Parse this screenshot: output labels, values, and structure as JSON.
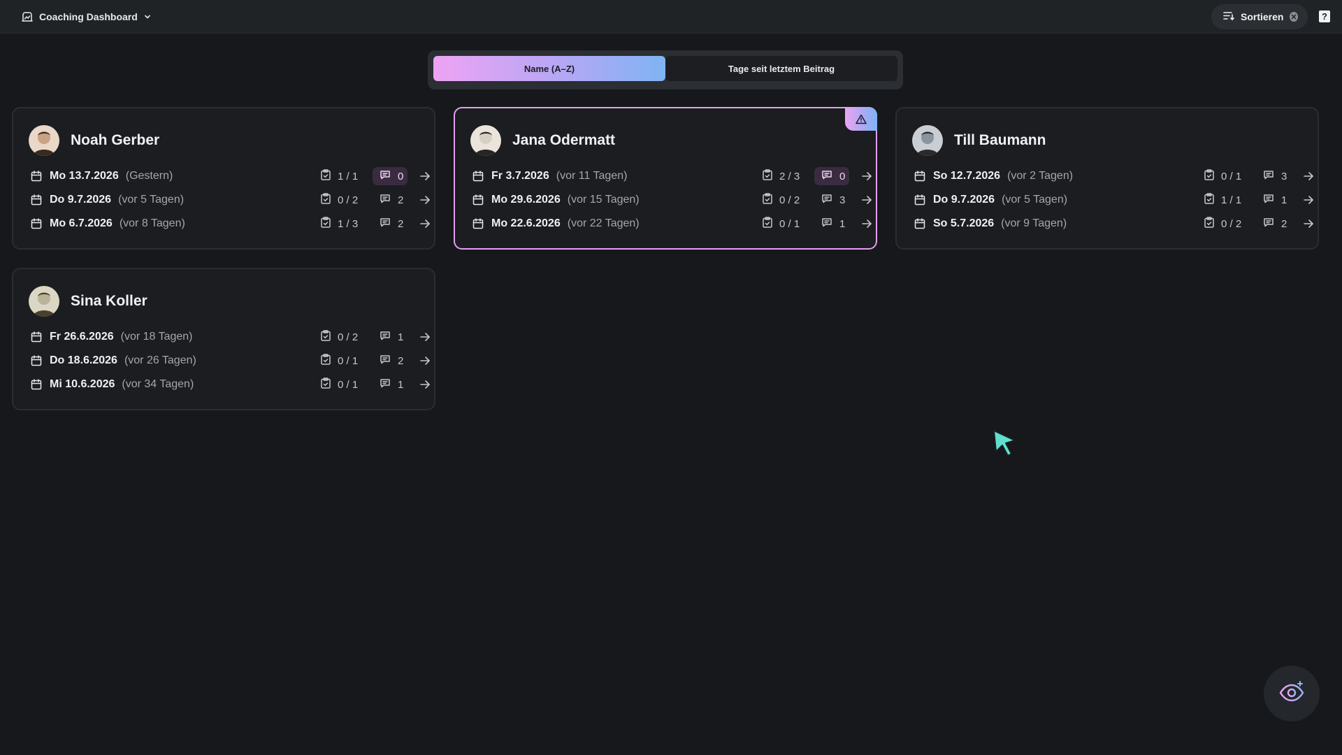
{
  "topbar": {
    "dashboard_title": "Coaching Dashboard",
    "sort_label": "Sortieren",
    "help_label": "?"
  },
  "sort_options": [
    {
      "label": "Name (A–Z)",
      "active": true
    },
    {
      "label": "Tage seit letztem Beitrag",
      "active": false
    }
  ],
  "colors": {
    "accent_gradient_start": "#eea3f3",
    "accent_gradient_end": "#7fb4f3",
    "highlight_border": "#e59ef0",
    "comment_highlight_bg": "#3a2b40"
  },
  "cards": [
    {
      "name": "Noah Gerber",
      "warning": false,
      "rows": [
        {
          "date": "Mo 13.7.2026",
          "relative": "(Gestern)",
          "tasks": "1 / 1",
          "comments": "0",
          "comments_highlight": true
        },
        {
          "date": "Do 9.7.2026",
          "relative": "(vor 5 Tagen)",
          "tasks": "0 / 2",
          "comments": "2",
          "comments_highlight": false
        },
        {
          "date": "Mo 6.7.2026",
          "relative": "(vor 8 Tagen)",
          "tasks": "1 / 3",
          "comments": "2",
          "comments_highlight": false
        }
      ]
    },
    {
      "name": "Jana Odermatt",
      "warning": true,
      "rows": [
        {
          "date": "Fr 3.7.2026",
          "relative": "(vor 11 Tagen)",
          "tasks": "2 / 3",
          "comments": "0",
          "comments_highlight": true
        },
        {
          "date": "Mo 29.6.2026",
          "relative": "(vor 15 Tagen)",
          "tasks": "0 / 2",
          "comments": "3",
          "comments_highlight": false
        },
        {
          "date": "Mo 22.6.2026",
          "relative": "(vor 22 Tagen)",
          "tasks": "0 / 1",
          "comments": "1",
          "comments_highlight": false
        }
      ]
    },
    {
      "name": "Till Baumann",
      "warning": false,
      "rows": [
        {
          "date": "So 12.7.2026",
          "relative": "(vor 2 Tagen)",
          "tasks": "0 / 1",
          "comments": "3",
          "comments_highlight": false
        },
        {
          "date": "Do 9.7.2026",
          "relative": "(vor 5 Tagen)",
          "tasks": "1 / 1",
          "comments": "1",
          "comments_highlight": false
        },
        {
          "date": "So 5.7.2026",
          "relative": "(vor 9 Tagen)",
          "tasks": "0 / 2",
          "comments": "2",
          "comments_highlight": false
        }
      ]
    },
    {
      "name": "Sina Koller",
      "warning": false,
      "rows": [
        {
          "date": "Fr 26.6.2026",
          "relative": "(vor 18 Tagen)",
          "tasks": "0 / 2",
          "comments": "1",
          "comments_highlight": false
        },
        {
          "date": "Do 18.6.2026",
          "relative": "(vor 26 Tagen)",
          "tasks": "0 / 1",
          "comments": "2",
          "comments_highlight": false
        },
        {
          "date": "Mi 10.6.2026",
          "relative": "(vor 34 Tagen)",
          "tasks": "0 / 1",
          "comments": "1",
          "comments_highlight": false
        }
      ]
    }
  ]
}
